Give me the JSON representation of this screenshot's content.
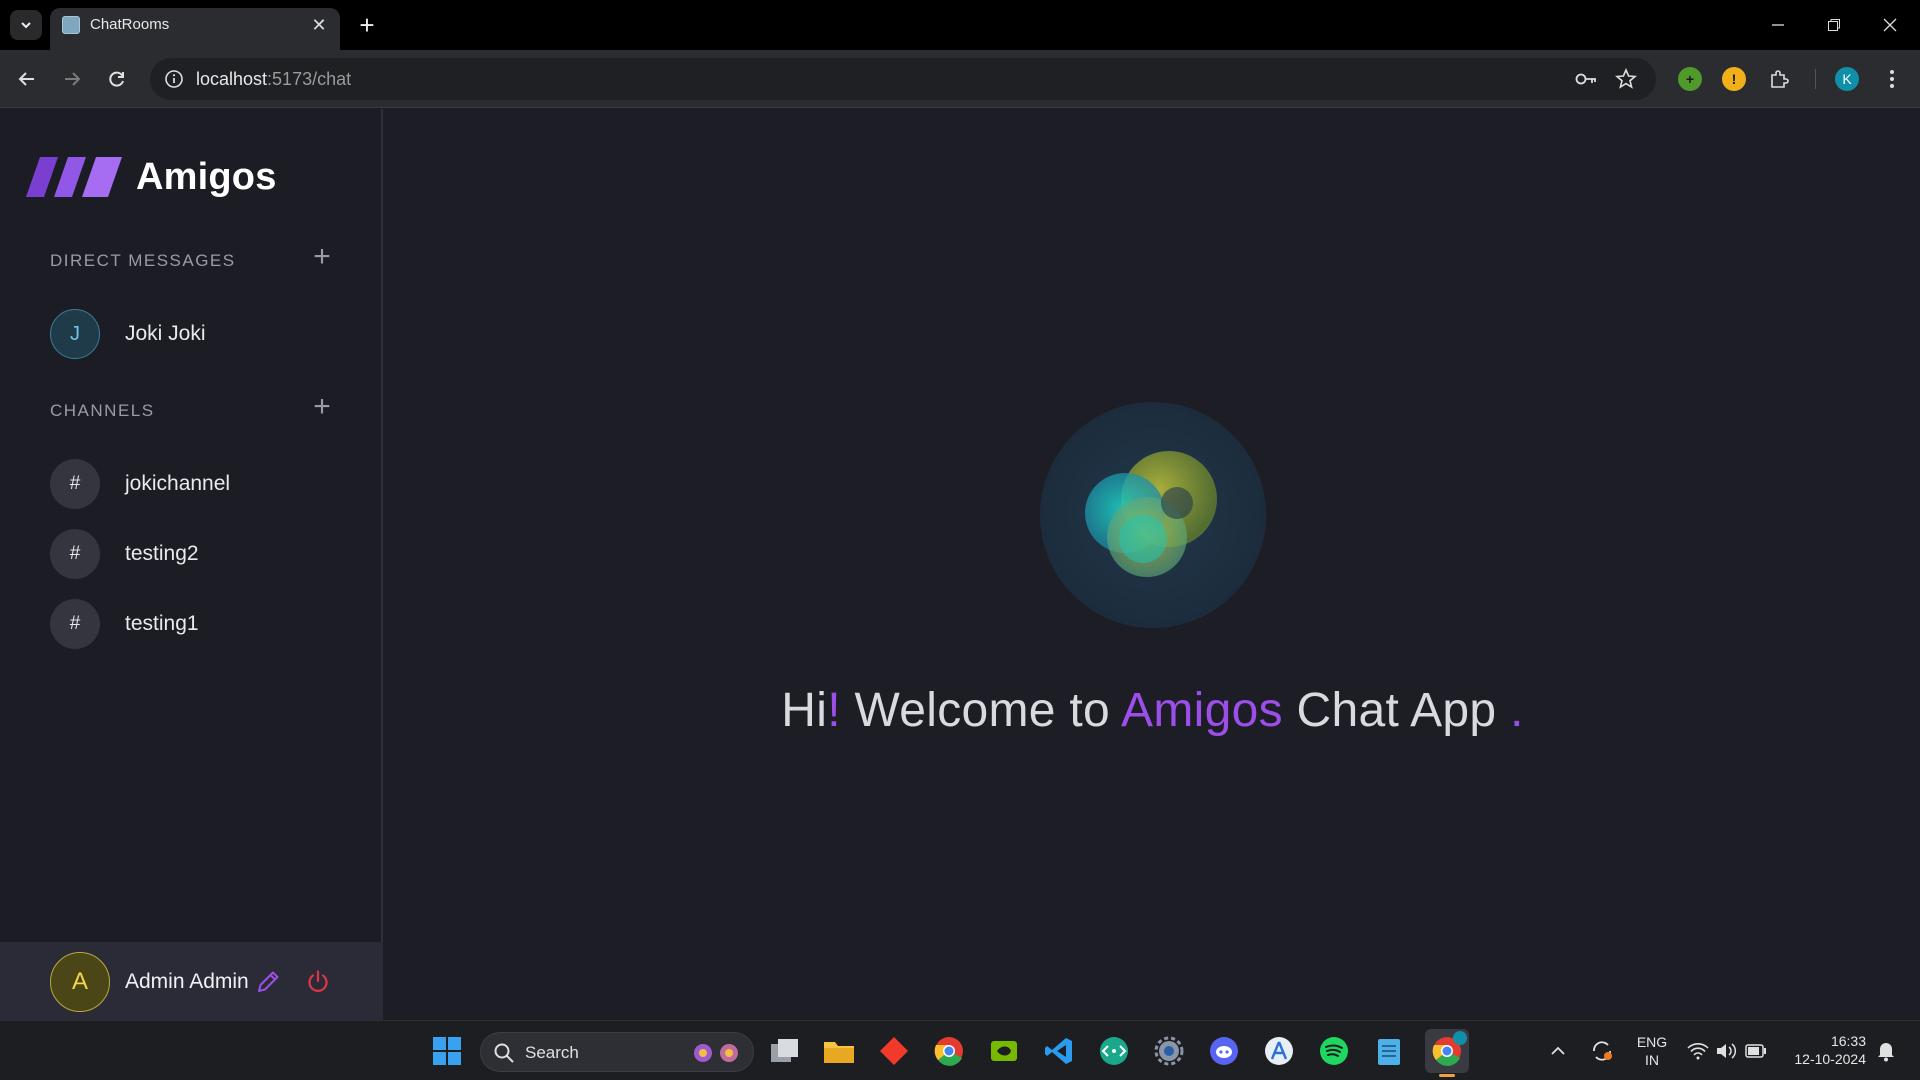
{
  "browser": {
    "tab": {
      "title": "ChatRooms"
    },
    "url": {
      "host": "localhost",
      "path": ":5173/chat"
    },
    "profile_initial": "K"
  },
  "sidebar": {
    "brand": "Amigos",
    "direct_messages": {
      "title": "DIRECT MESSAGES",
      "items": [
        {
          "initial": "J",
          "name": "Joki Joki"
        }
      ]
    },
    "channels": {
      "title": "CHANNELS",
      "items": [
        {
          "icon": "#",
          "name": "jokichannel"
        },
        {
          "icon": "#",
          "name": "testing2"
        },
        {
          "icon": "#",
          "name": "testing1"
        }
      ]
    },
    "profile": {
      "initial": "A",
      "name": "Admin Admin"
    }
  },
  "welcome": {
    "hi": "Hi",
    "bang": "!",
    "welcome_to": " Welcome to ",
    "brand": "Amigos",
    "rest": " Chat App ",
    "dot": "."
  },
  "taskbar": {
    "search_label": "Search",
    "language": {
      "line1": "ENG",
      "line2": "IN"
    },
    "clock": {
      "time": "16:33",
      "date": "12-10-2024"
    }
  },
  "colors": {
    "accent": "#9b4ee8",
    "background": "#1c1d25",
    "sidebar": "#1b1c24",
    "profile_bar": "#2a2b36"
  }
}
